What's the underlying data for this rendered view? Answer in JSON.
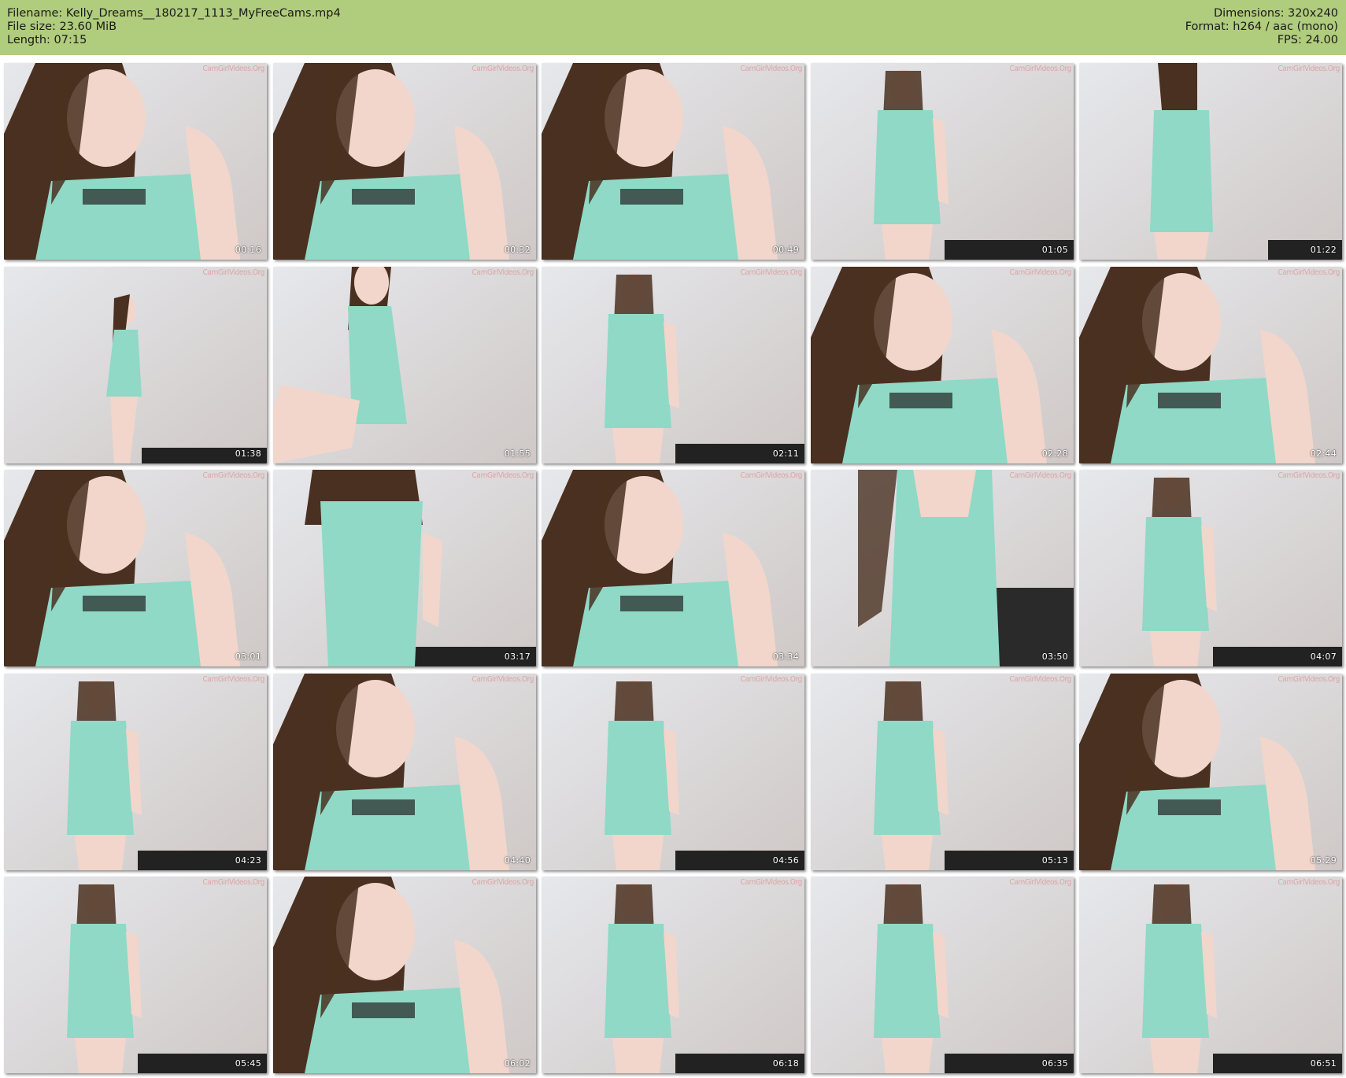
{
  "header": {
    "filename_line": "Filename: Kelly_Dreams__180217_1113_MyFreeCams.mp4",
    "filesize_line": "File size: 23.60 MiB",
    "length_line": "Length: 07:15",
    "dimensions_line": "Dimensions: 320x240",
    "format_line": "Format: h264 / aac (mono)",
    "fps_line": "FPS: 24.00",
    "background_color": "#b0cc7d"
  },
  "watermark": "CamGirlVideos.Org",
  "thumbnails": [
    {
      "timestamp": "00:16",
      "scene": "closeup"
    },
    {
      "timestamp": "00:32",
      "scene": "closeup"
    },
    {
      "timestamp": "00:49",
      "scene": "closeup"
    },
    {
      "timestamp": "01:05",
      "scene": "standing"
    },
    {
      "timestamp": "01:22",
      "scene": "back"
    },
    {
      "timestamp": "01:38",
      "scene": "side-small"
    },
    {
      "timestamp": "01:55",
      "scene": "sitting"
    },
    {
      "timestamp": "02:11",
      "scene": "standing"
    },
    {
      "timestamp": "02:28",
      "scene": "closeup"
    },
    {
      "timestamp": "02:44",
      "scene": "closeup"
    },
    {
      "timestamp": "03:01",
      "scene": "closeup"
    },
    {
      "timestamp": "03:17",
      "scene": "standing-close"
    },
    {
      "timestamp": "03:34",
      "scene": "closeup"
    },
    {
      "timestamp": "03:50",
      "scene": "torso"
    },
    {
      "timestamp": "04:07",
      "scene": "standing"
    },
    {
      "timestamp": "04:23",
      "scene": "standing"
    },
    {
      "timestamp": "04:40",
      "scene": "closeup"
    },
    {
      "timestamp": "04:56",
      "scene": "standing"
    },
    {
      "timestamp": "05:13",
      "scene": "standing"
    },
    {
      "timestamp": "05:29",
      "scene": "closeup"
    },
    {
      "timestamp": "05:45",
      "scene": "standing"
    },
    {
      "timestamp": "06:02",
      "scene": "closeup"
    },
    {
      "timestamp": "06:18",
      "scene": "standing"
    },
    {
      "timestamp": "06:35",
      "scene": "standing"
    },
    {
      "timestamp": "06:51",
      "scene": "standing"
    }
  ],
  "colors": {
    "dress": "#8fd9c6",
    "hair": "#4a3020",
    "skin": "#f2d6cb",
    "wall": "#dfe1e4"
  }
}
